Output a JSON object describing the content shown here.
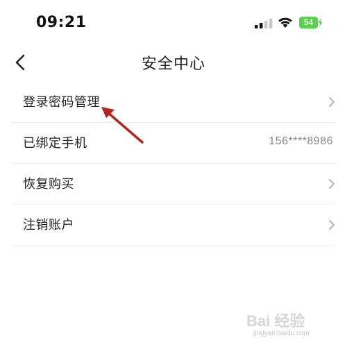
{
  "status_bar": {
    "time": "09:21",
    "battery_level": "54",
    "icons": [
      "signal-icon",
      "wifi-icon",
      "battery-icon"
    ]
  },
  "nav": {
    "title": "安全中心",
    "back_icon": "chevron-left-icon"
  },
  "menu": {
    "items": [
      {
        "label": "登录密码管理",
        "value": "",
        "icon": "chevron-right-icon"
      },
      {
        "label": "已绑定手机",
        "value": "156****8986",
        "icon": ""
      },
      {
        "label": "恢复购买",
        "value": "",
        "icon": "chevron-right-icon"
      },
      {
        "label": "注销账户",
        "value": "",
        "icon": "chevron-right-icon"
      }
    ]
  },
  "annotation": {
    "color": "#b3251e",
    "icon": "arrow-icon"
  },
  "watermark": {
    "logo": "Bai 经验",
    "url": "jingyan.baidu.com"
  },
  "colors": {
    "battery": "#59d24d",
    "divider": "#eeeeee",
    "value_text": "#888888"
  }
}
